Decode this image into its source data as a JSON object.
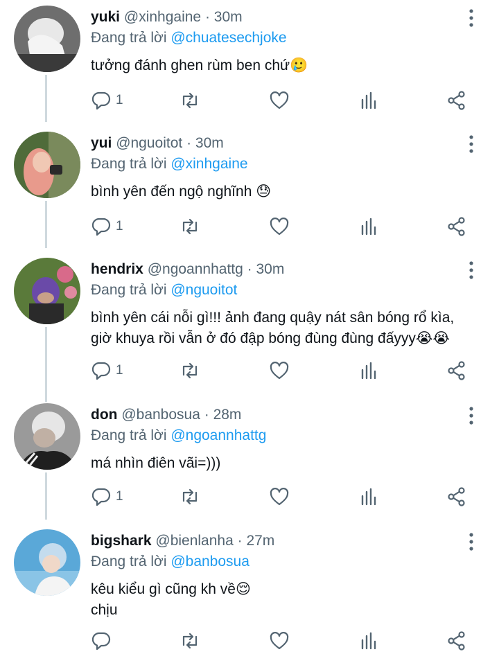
{
  "tweets": [
    {
      "name": "yuki",
      "handle": "@xinhgaine",
      "dot": " · ",
      "time": "30m",
      "replying_prefix": "Đang trả lời ",
      "replying_to": "@chuatesechjoke",
      "text": "tưởng đánh ghen rùm ben chứ🥲",
      "reply_count": "1"
    },
    {
      "name": "yui",
      "handle": "@nguoitot",
      "dot": " · ",
      "time": "30m",
      "replying_prefix": "Đang trả lời ",
      "replying_to": "@xinhgaine",
      "text": "bình yên đến ngộ nghĩnh 😓",
      "reply_count": "1"
    },
    {
      "name": "hendrix",
      "handle": "@ngoannhattg",
      "dot": " · ",
      "time": "30m",
      "replying_prefix": "Đang trả lời ",
      "replying_to": "@nguoitot",
      "text": "bình yên cái nỗi gì!!! ảnh đang quậy nát sân bóng rổ kìa,\ngiờ khuya rồi vẫn ở đó đập bóng đùng đùng đấyyy😭😭",
      "reply_count": "1"
    },
    {
      "name": "don",
      "handle": "@banbosua",
      "dot": " · ",
      "time": "28m",
      "replying_prefix": "Đang trả lời ",
      "replying_to": "@ngoannhattg",
      "text": "má nhìn điên vãi=)))",
      "reply_count": "1"
    },
    {
      "name": "bigshark",
      "handle": "@bienlanha",
      "dot": " · ",
      "time": "27m",
      "replying_prefix": "Đang trả lời ",
      "replying_to": "@banbosua",
      "text": "kêu kiểu gì cũng kh về😌\nchịu",
      "reply_count": ""
    }
  ],
  "icons": {
    "reply": "reply-icon",
    "retweet": "retweet-icon",
    "like": "heart-icon",
    "stats": "analytics-icon",
    "share": "share-icon",
    "more": "more-vertical-icon"
  },
  "colors": {
    "link": "#1d9bf0",
    "muted": "#536471",
    "text": "#0f1419",
    "thread": "#cfd9de"
  }
}
